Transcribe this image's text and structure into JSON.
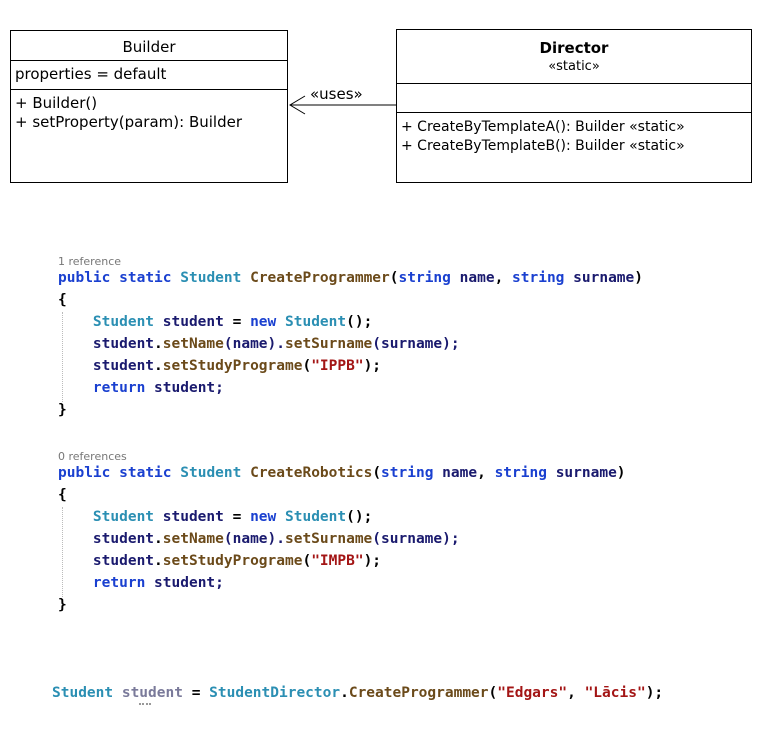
{
  "uml": {
    "builder": {
      "title": "Builder",
      "attribute": "properties = default",
      "methods": [
        "+ Builder()",
        "+ setProperty(param): Builder"
      ]
    },
    "director": {
      "title": "Director",
      "stereotype": "«static»",
      "methods": [
        "+ CreateByTemplateA(): Builder «static»",
        "+ CreateByTemplateB(): Builder «static»"
      ]
    },
    "association_label": "«uses»"
  },
  "code": {
    "method1": {
      "references": "1 reference",
      "line1": {
        "kw1": "public",
        "kw2": "static",
        "type": "Student",
        "name": "CreateProgrammer",
        "p_open": "(",
        "pt1": "string",
        "pn1": "name",
        "comma": ",",
        "pt2": "string",
        "pn2": "surname",
        "p_close": ")"
      },
      "open_brace": "{",
      "body": {
        "l1": {
          "type": "Student",
          "var": "student",
          "eq": "=",
          "kw": "new",
          "ctor": "Student",
          "tail": "();"
        },
        "l2": {
          "obj": "student",
          "dot1": ".",
          "m1": "setName",
          "a1": "(name).",
          "m2": "setSurname",
          "a2": "(surname);"
        },
        "l3": {
          "obj": "student",
          "dot": ".",
          "m": "setStudyPrograme",
          "open": "(",
          "str": "\"IPPB\"",
          "close": ");"
        },
        "l4": {
          "kw": "return",
          "val": "student;"
        }
      },
      "close_brace": "}"
    },
    "method2": {
      "references": "0 references",
      "line1": {
        "kw1": "public",
        "kw2": "static",
        "type": "Student",
        "name": "CreateRobotics",
        "p_open": "(",
        "pt1": "string",
        "pn1": "name",
        "comma": ",",
        "pt2": "string",
        "pn2": "surname",
        "p_close": ")"
      },
      "open_brace": "{",
      "body": {
        "l1": {
          "type": "Student",
          "var": "student",
          "eq": "=",
          "kw": "new",
          "ctor": "Student",
          "tail": "();"
        },
        "l2": {
          "obj": "student",
          "dot1": ".",
          "m1": "setName",
          "a1": "(name).",
          "m2": "setSurname",
          "a2": "(surname);"
        },
        "l3": {
          "obj": "student",
          "dot": ".",
          "m": "setStudyPrograme",
          "open": "(",
          "str": "\"IMPB\"",
          "close": ");"
        },
        "l4": {
          "kw": "return",
          "val": "student;"
        }
      },
      "close_brace": "}"
    },
    "usage": {
      "type": "Student",
      "var": "student",
      "eq": "=",
      "cls": "StudentDirector",
      "dot": ".",
      "m": "CreateProgrammer",
      "open": "(",
      "s1": "\"Edgars\"",
      "comma": ",",
      "s2": "\"Lācis\"",
      "close": ");"
    }
  }
}
